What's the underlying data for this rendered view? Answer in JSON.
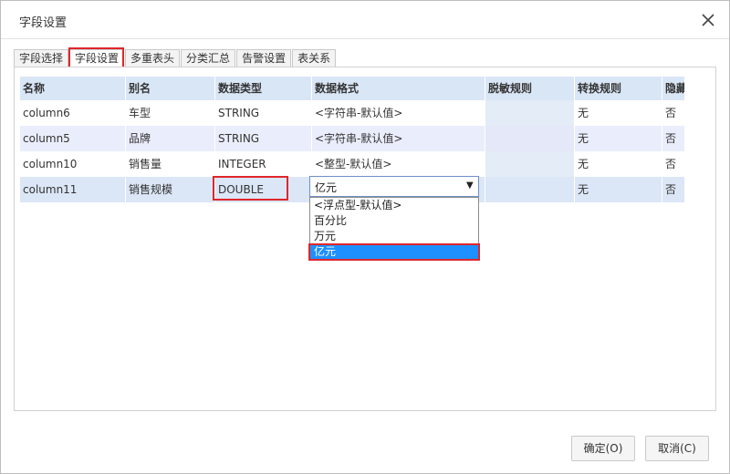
{
  "dialog": {
    "title": "字段设置"
  },
  "tabs": [
    {
      "label": "字段选择"
    },
    {
      "label": "字段设置"
    },
    {
      "label": "多重表头"
    },
    {
      "label": "分类汇总"
    },
    {
      "label": "告警设置"
    },
    {
      "label": "表关系"
    }
  ],
  "active_tab": "字段设置",
  "table": {
    "headers": [
      "名称",
      "别名",
      "数据类型",
      "数据格式",
      "脱敏规则",
      "转换规则",
      "隐藏"
    ],
    "rows": [
      [
        "column6",
        "车型",
        "STRING",
        "<字符串-默认值>",
        "",
        "无",
        "否"
      ],
      [
        "column5",
        "品牌",
        "STRING",
        "<字符串-默认值>",
        "",
        "无",
        "否"
      ],
      [
        "column10",
        "销售量",
        "INTEGER",
        "<整型-默认值>",
        "",
        "无",
        "否"
      ],
      [
        "column11",
        "销售规模",
        "DOUBLE",
        "",
        "",
        "无",
        "否"
      ]
    ]
  },
  "format_select": {
    "value": "亿元",
    "options": [
      "<浮点型-默认值>",
      "百分比",
      "万元",
      "亿元"
    ],
    "selected": "亿元"
  },
  "colors": {
    "highlight_red": "#e0262a",
    "option_selected": "#1e90ff",
    "header_bg": "#d9e6f6"
  },
  "buttons": {
    "ok": "确定(O)",
    "cancel": "取消(C)"
  },
  "icons": {
    "close": "close-icon",
    "dropdown_arrow": "dropdown-arrow-icon"
  }
}
